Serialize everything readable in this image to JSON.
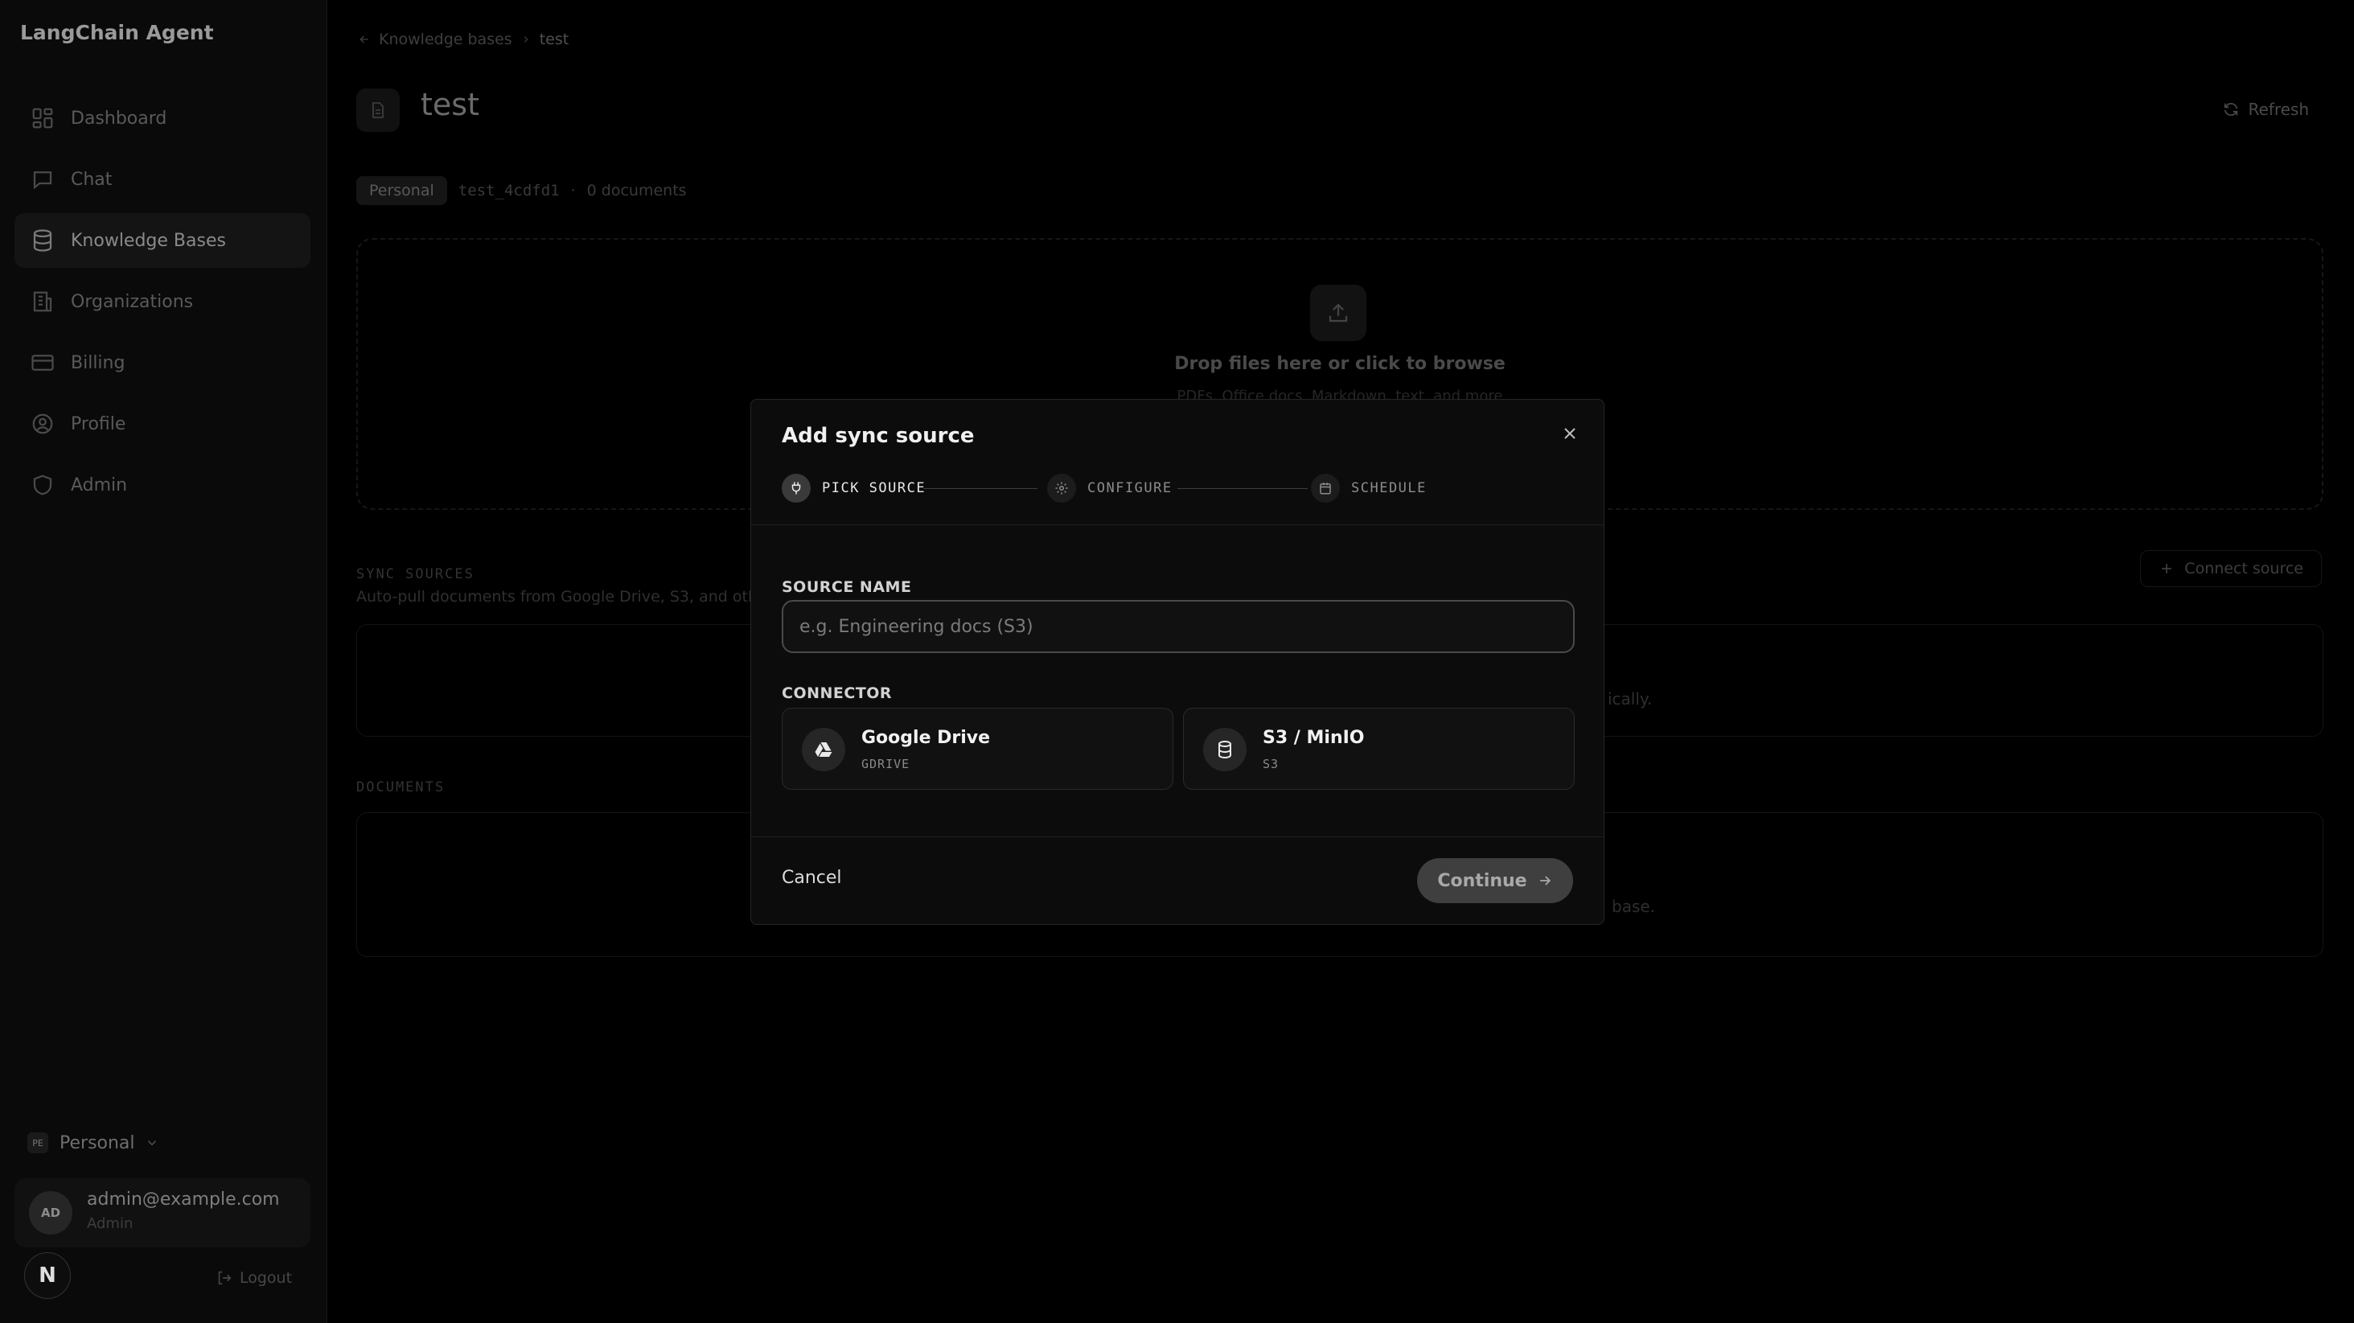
{
  "app": {
    "title": "LangChain Agent"
  },
  "sidebar": {
    "items": [
      {
        "label": "Dashboard",
        "icon": "dashboard-icon"
      },
      {
        "label": "Chat",
        "icon": "chat-icon"
      },
      {
        "label": "Knowledge Bases",
        "icon": "database-icon",
        "active": true
      },
      {
        "label": "Organizations",
        "icon": "building-icon"
      },
      {
        "label": "Billing",
        "icon": "credit-card-icon"
      },
      {
        "label": "Profile",
        "icon": "user-circle-icon"
      },
      {
        "label": "Admin",
        "icon": "shield-icon"
      }
    ],
    "org": {
      "badge": "PE",
      "name": "Personal"
    },
    "user": {
      "initials": "AD",
      "email": "admin@example.com",
      "role": "Admin"
    },
    "logo": "N",
    "logout_label": "Logout"
  },
  "main": {
    "breadcrumb": {
      "parent": "Knowledge bases",
      "current": "test"
    },
    "title": "test",
    "refresh_label": "Refresh",
    "meta": {
      "scope": "Personal",
      "id": "test_4cdfd1",
      "sep": "·",
      "doc_count": "0 documents"
    },
    "dropzone": {
      "title": "Drop files here or click to browse",
      "subtitle": "PDFs, Office docs, Markdown, text, and more"
    },
    "sync_sources": {
      "label": "SYNC SOURCES",
      "description": "Auto-pull documents from Google Drive, S3, and other",
      "connect_label": "Connect source",
      "empty_fragment": "ically."
    },
    "documents": {
      "label": "DOCUMENTS",
      "empty_fragment": "base."
    }
  },
  "modal": {
    "title": "Add sync source",
    "steps": [
      {
        "label": "PICK SOURCE",
        "state": "active"
      },
      {
        "label": "CONFIGURE",
        "state": "pending"
      },
      {
        "label": "SCHEDULE",
        "state": "pending"
      }
    ],
    "source_name": {
      "label": "SOURCE NAME",
      "placeholder": "e.g. Engineering docs (S3)",
      "value": ""
    },
    "connector": {
      "label": "CONNECTOR",
      "options": [
        {
          "name": "Google Drive",
          "code": "GDRIVE",
          "icon": "google-drive-icon"
        },
        {
          "name": "S3 / MinIO",
          "code": "S3",
          "icon": "database-icon"
        }
      ]
    },
    "cancel_label": "Cancel",
    "continue_label": "Continue"
  },
  "colors": {
    "background": "#000000",
    "modal_bg": "#0c0c0c",
    "accent": "#3f3f3f",
    "text": "#f0f0f0"
  }
}
